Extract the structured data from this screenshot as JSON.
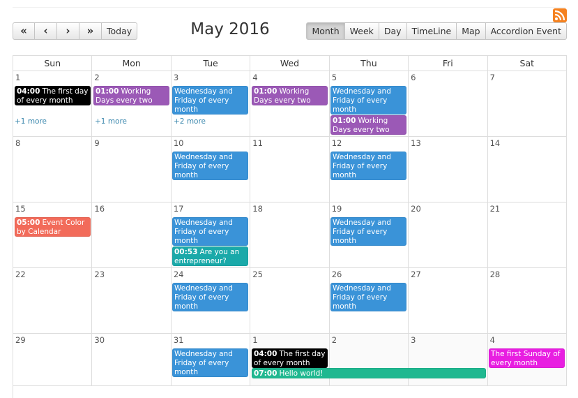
{
  "colors": {
    "blue": "#3a93d8",
    "purple": "#9b59b6",
    "black": "#000000",
    "orange": "#f26b5a",
    "teal": "#1aa9a9",
    "green": "#1fb890",
    "magenta": "#e81ee1",
    "rss": "#f58220"
  },
  "header": {
    "rss_icon": "rss-feed-icon",
    "title": "May 2016",
    "nav": {
      "prev_year": "«",
      "prev": "‹",
      "next": "›",
      "next_year": "»",
      "today": "Today"
    },
    "views": [
      "Month",
      "Week",
      "Day",
      "TimeLine",
      "Map",
      "Accordion Event"
    ],
    "active_view": "Month"
  },
  "weekdays": [
    "Sun",
    "Mon",
    "Tue",
    "Wed",
    "Thu",
    "Fri",
    "Sat"
  ],
  "weeks": [
    {
      "days": [
        "1",
        "2",
        "3",
        "4",
        "5",
        "6",
        "7"
      ]
    },
    {
      "days": [
        "8",
        "9",
        "10",
        "11",
        "12",
        "13",
        "14"
      ]
    },
    {
      "days": [
        "15",
        "16",
        "17",
        "18",
        "19",
        "20",
        "21"
      ]
    },
    {
      "days": [
        "22",
        "23",
        "24",
        "25",
        "26",
        "27",
        "28"
      ]
    },
    {
      "days": [
        "29",
        "30",
        "31",
        "1",
        "2",
        "3",
        "4"
      ]
    }
  ],
  "events": {
    "w1_sun": {
      "time": "04:00",
      "title": "The first day of every month"
    },
    "w1_sun_more": "+1 more",
    "w1_mon": {
      "time": "01:00",
      "title": "Working Days every two weeks"
    },
    "w1_mon_more": "+1 more",
    "w1_tue": {
      "title": "Wednesday and Friday of every month"
    },
    "w1_tue_more": "+2 more",
    "w1_wed": {
      "time": "01:00",
      "title": "Working Days every two weeks"
    },
    "w1_thu_a": {
      "title": "Wednesday and Friday of every month"
    },
    "w1_thu_b": {
      "time": "01:00",
      "title": "Working Days every two weeks"
    },
    "w2_tue": {
      "title": "Wednesday and Friday of every month"
    },
    "w2_thu": {
      "title": "Wednesday and Friday of every month"
    },
    "w3_sun": {
      "time": "05:00",
      "title": "Event Color by Calendar (Orange)"
    },
    "w3_tue_a": {
      "title": "Wednesday and Friday of every month"
    },
    "w3_tue_b": {
      "time": "00:53",
      "title": "Are you an entrepreneur?"
    },
    "w3_thu": {
      "title": "Wednesday and Friday of every month"
    },
    "w4_tue": {
      "title": "Wednesday and Friday of every month"
    },
    "w4_thu": {
      "title": "Wednesday and Friday of every month"
    },
    "w5_tue": {
      "title": "Wednesday and Friday of every month"
    },
    "w5_wed_a": {
      "time": "04:00",
      "title": "The first day of every month"
    },
    "w5_wed_b": {
      "time": "07:00",
      "title": "Hello world!"
    },
    "w5_sat": {
      "title": "The first Sunday of every month"
    }
  }
}
